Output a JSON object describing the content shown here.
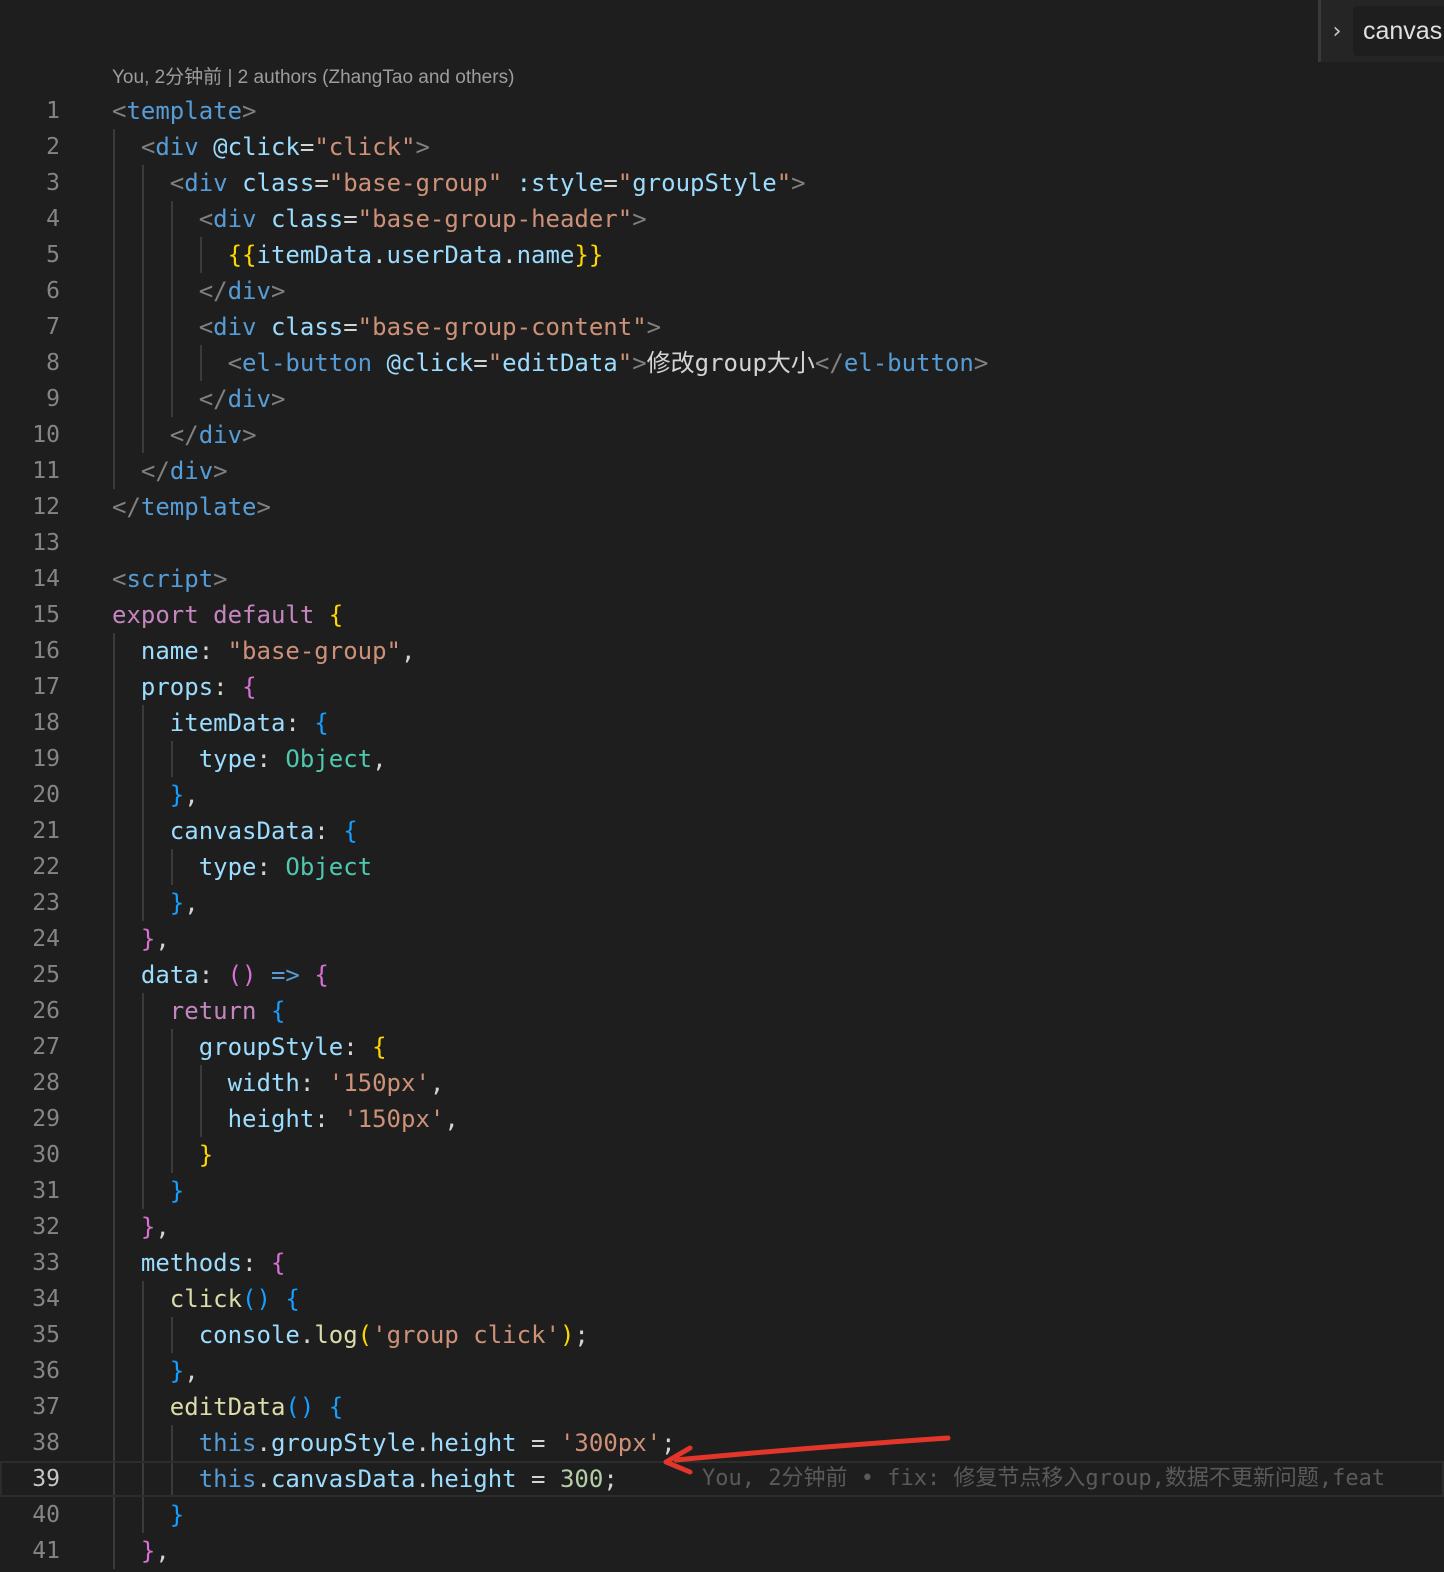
{
  "breadcrumb": {
    "label": "canvas",
    "chevron": "›"
  },
  "codelens": "You, 2分钟前 | 2 authors (ZhangTao and others)",
  "current_line": 39,
  "blame_text": "You, 2分钟前 • fix: 修复节点移入group,数据不更新问题,feat",
  "colors": {
    "background": "#1e1e1e",
    "tag": "#569cd6",
    "string": "#ce9178",
    "keyword": "#c586c0",
    "property": "#9cdcfe",
    "arrow": "#e2362a"
  },
  "code_lines": [
    [
      [
        "b",
        "<"
      ],
      [
        "t",
        "template"
      ],
      [
        "b",
        ">"
      ]
    ],
    [
      [
        "x",
        "  "
      ],
      [
        "b",
        "<"
      ],
      [
        "t",
        "div"
      ],
      [
        "x",
        " "
      ],
      [
        "a",
        "@click"
      ],
      [
        "x",
        "="
      ],
      [
        "s",
        "\"click\""
      ],
      [
        "b",
        ">"
      ]
    ],
    [
      [
        "x",
        "    "
      ],
      [
        "b",
        "<"
      ],
      [
        "t",
        "div"
      ],
      [
        "x",
        " "
      ],
      [
        "a",
        "class"
      ],
      [
        "x",
        "="
      ],
      [
        "s",
        "\"base-group\""
      ],
      [
        "x",
        " "
      ],
      [
        "a",
        ":style"
      ],
      [
        "x",
        "="
      ],
      [
        "s",
        "\""
      ],
      [
        "a",
        "groupStyle"
      ],
      [
        "s",
        "\""
      ],
      [
        "b",
        ">"
      ]
    ],
    [
      [
        "x",
        "      "
      ],
      [
        "b",
        "<"
      ],
      [
        "t",
        "div"
      ],
      [
        "x",
        " "
      ],
      [
        "a",
        "class"
      ],
      [
        "x",
        "="
      ],
      [
        "s",
        "\"base-group-header\""
      ],
      [
        "b",
        ">"
      ]
    ],
    [
      [
        "x",
        "        "
      ],
      [
        "y",
        "{{"
      ],
      [
        "p",
        "itemData"
      ],
      [
        "x",
        "."
      ],
      [
        "p",
        "userData"
      ],
      [
        "x",
        "."
      ],
      [
        "p",
        "name"
      ],
      [
        "y",
        "}}"
      ]
    ],
    [
      [
        "x",
        "      "
      ],
      [
        "b",
        "</"
      ],
      [
        "t",
        "div"
      ],
      [
        "b",
        ">"
      ]
    ],
    [
      [
        "x",
        "      "
      ],
      [
        "b",
        "<"
      ],
      [
        "t",
        "div"
      ],
      [
        "x",
        " "
      ],
      [
        "a",
        "class"
      ],
      [
        "x",
        "="
      ],
      [
        "s",
        "\"base-group-content\""
      ],
      [
        "b",
        ">"
      ]
    ],
    [
      [
        "x",
        "        "
      ],
      [
        "b",
        "<"
      ],
      [
        "t",
        "el-button"
      ],
      [
        "x",
        " "
      ],
      [
        "a",
        "@click"
      ],
      [
        "x",
        "="
      ],
      [
        "s",
        "\""
      ],
      [
        "a",
        "editData"
      ],
      [
        "s",
        "\""
      ],
      [
        "b",
        ">"
      ],
      [
        "x",
        "修改group大小"
      ],
      [
        "b",
        "</"
      ],
      [
        "t",
        "el-button"
      ],
      [
        "b",
        ">"
      ]
    ],
    [
      [
        "x",
        "      "
      ],
      [
        "b",
        "</"
      ],
      [
        "t",
        "div"
      ],
      [
        "b",
        ">"
      ]
    ],
    [
      [
        "x",
        "    "
      ],
      [
        "b",
        "</"
      ],
      [
        "t",
        "div"
      ],
      [
        "b",
        ">"
      ]
    ],
    [
      [
        "x",
        "  "
      ],
      [
        "b",
        "</"
      ],
      [
        "t",
        "div"
      ],
      [
        "b",
        ">"
      ]
    ],
    [
      [
        "b",
        "</"
      ],
      [
        "t",
        "template"
      ],
      [
        "b",
        ">"
      ]
    ],
    [],
    [
      [
        "b",
        "<"
      ],
      [
        "t",
        "script"
      ],
      [
        "b",
        ">"
      ]
    ],
    [
      [
        "k",
        "export"
      ],
      [
        "x",
        " "
      ],
      [
        "k",
        "default"
      ],
      [
        "x",
        " "
      ],
      [
        "b1",
        "{"
      ]
    ],
    [
      [
        "x",
        "  "
      ],
      [
        "p",
        "name"
      ],
      [
        "x",
        ": "
      ],
      [
        "s",
        "\"base-group\""
      ],
      [
        "x",
        ","
      ]
    ],
    [
      [
        "x",
        "  "
      ],
      [
        "p",
        "props"
      ],
      [
        "x",
        ": "
      ],
      [
        "b2",
        "{"
      ]
    ],
    [
      [
        "x",
        "    "
      ],
      [
        "p",
        "itemData"
      ],
      [
        "x",
        ": "
      ],
      [
        "b3",
        "{"
      ]
    ],
    [
      [
        "x",
        "      "
      ],
      [
        "p",
        "type"
      ],
      [
        "x",
        ": "
      ],
      [
        "ty",
        "Object"
      ],
      [
        "x",
        ","
      ]
    ],
    [
      [
        "x",
        "    "
      ],
      [
        "b3",
        "}"
      ],
      [
        "x",
        ","
      ]
    ],
    [
      [
        "x",
        "    "
      ],
      [
        "p",
        "canvasData"
      ],
      [
        "x",
        ": "
      ],
      [
        "b3",
        "{"
      ]
    ],
    [
      [
        "x",
        "      "
      ],
      [
        "p",
        "type"
      ],
      [
        "x",
        ": "
      ],
      [
        "ty",
        "Object"
      ]
    ],
    [
      [
        "x",
        "    "
      ],
      [
        "b3",
        "}"
      ],
      [
        "x",
        ","
      ]
    ],
    [
      [
        "x",
        "  "
      ],
      [
        "b2",
        "}"
      ],
      [
        "x",
        ","
      ]
    ],
    [
      [
        "x",
        "  "
      ],
      [
        "p",
        "data"
      ],
      [
        "x",
        ": "
      ],
      [
        "b2",
        "()"
      ],
      [
        "x",
        " "
      ],
      [
        "t",
        "=>"
      ],
      [
        "x",
        " "
      ],
      [
        "b2",
        "{"
      ]
    ],
    [
      [
        "x",
        "    "
      ],
      [
        "k",
        "return"
      ],
      [
        "x",
        " "
      ],
      [
        "b3",
        "{"
      ]
    ],
    [
      [
        "x",
        "      "
      ],
      [
        "p",
        "groupStyle"
      ],
      [
        "x",
        ": "
      ],
      [
        "b1",
        "{"
      ]
    ],
    [
      [
        "x",
        "        "
      ],
      [
        "p",
        "width"
      ],
      [
        "x",
        ": "
      ],
      [
        "s",
        "'150px'"
      ],
      [
        "x",
        ","
      ]
    ],
    [
      [
        "x",
        "        "
      ],
      [
        "p",
        "height"
      ],
      [
        "x",
        ": "
      ],
      [
        "s",
        "'150px'"
      ],
      [
        "x",
        ","
      ]
    ],
    [
      [
        "x",
        "      "
      ],
      [
        "b1",
        "}"
      ]
    ],
    [
      [
        "x",
        "    "
      ],
      [
        "b3",
        "}"
      ]
    ],
    [
      [
        "x",
        "  "
      ],
      [
        "b2",
        "}"
      ],
      [
        "x",
        ","
      ]
    ],
    [
      [
        "x",
        "  "
      ],
      [
        "p",
        "methods"
      ],
      [
        "x",
        ": "
      ],
      [
        "b2",
        "{"
      ]
    ],
    [
      [
        "x",
        "    "
      ],
      [
        "f",
        "click"
      ],
      [
        "b3",
        "()"
      ],
      [
        "x",
        " "
      ],
      [
        "b3",
        "{"
      ]
    ],
    [
      [
        "x",
        "      "
      ],
      [
        "p",
        "console"
      ],
      [
        "x",
        "."
      ],
      [
        "f",
        "log"
      ],
      [
        "b1",
        "("
      ],
      [
        "s",
        "'group click'"
      ],
      [
        "b1",
        ")"
      ],
      [
        "x",
        ";"
      ]
    ],
    [
      [
        "x",
        "    "
      ],
      [
        "b3",
        "}"
      ],
      [
        "x",
        ","
      ]
    ],
    [
      [
        "x",
        "    "
      ],
      [
        "f",
        "editData"
      ],
      [
        "b3",
        "()"
      ],
      [
        "x",
        " "
      ],
      [
        "b3",
        "{"
      ]
    ],
    [
      [
        "x",
        "      "
      ],
      [
        "th",
        "this"
      ],
      [
        "x",
        "."
      ],
      [
        "p",
        "groupStyle"
      ],
      [
        "x",
        "."
      ],
      [
        "p",
        "height"
      ],
      [
        "x",
        " = "
      ],
      [
        "s",
        "'300px'"
      ],
      [
        "x",
        ";"
      ]
    ],
    [
      [
        "x",
        "      "
      ],
      [
        "th",
        "this"
      ],
      [
        "x",
        "."
      ],
      [
        "p",
        "canvasData"
      ],
      [
        "x",
        "."
      ],
      [
        "p",
        "height"
      ],
      [
        "x",
        " = "
      ],
      [
        "n",
        "300"
      ],
      [
        "x",
        ";"
      ]
    ],
    [
      [
        "x",
        "    "
      ],
      [
        "b3",
        "}"
      ]
    ],
    [
      [
        "x",
        "  "
      ],
      [
        "b2",
        "}"
      ],
      [
        "x",
        ","
      ]
    ]
  ]
}
